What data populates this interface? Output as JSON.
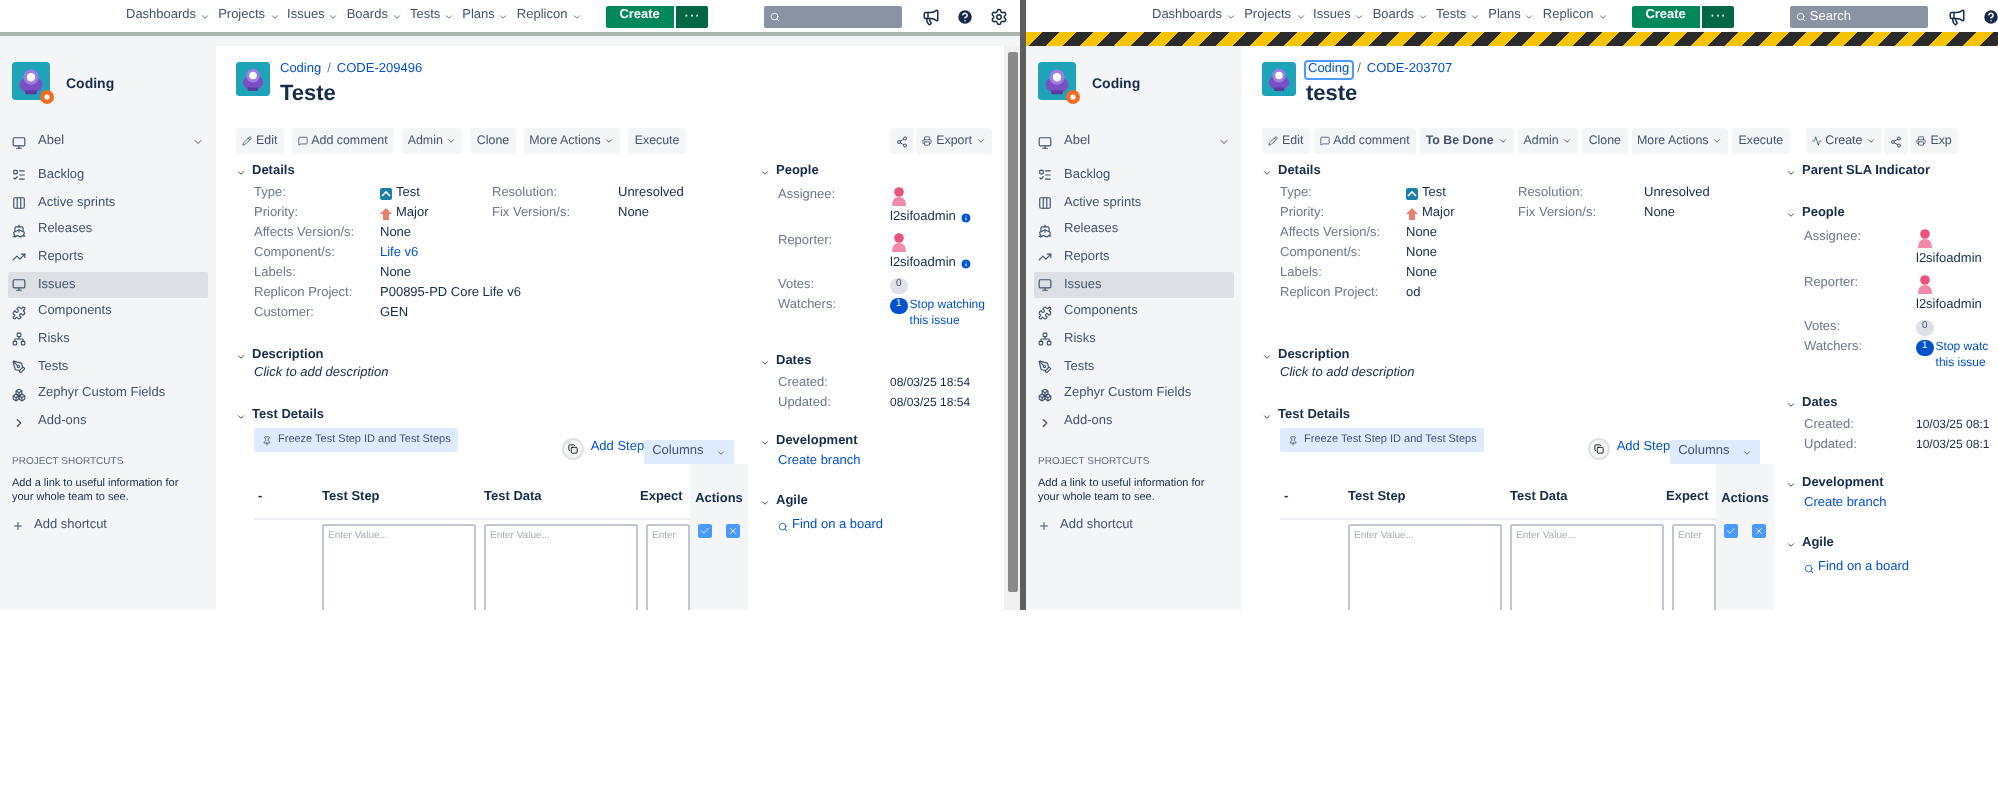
{
  "panes": [
    {
      "hazard": false,
      "nav": {
        "items": [
          "Dashboards",
          "Projects",
          "Issues",
          "Boards",
          "Tests",
          "Plans",
          "Replicon"
        ],
        "create": "Create",
        "more": "···"
      },
      "sidebar": {
        "project": "Coding",
        "board": "Abel",
        "items": [
          {
            "label": "Backlog",
            "kind": "backlog",
            "selected": false
          },
          {
            "label": "Active sprints",
            "kind": "sprints",
            "selected": false
          },
          {
            "label": "Releases",
            "kind": "releases",
            "selected": false
          },
          {
            "label": "Reports",
            "kind": "reports",
            "selected": false
          },
          {
            "label": "Issues",
            "kind": "issues",
            "selected": true
          },
          {
            "label": "Components",
            "kind": "components",
            "selected": false
          },
          {
            "label": "Risks",
            "kind": "risks",
            "selected": false
          },
          {
            "label": "Tests",
            "kind": "tests",
            "selected": false
          },
          {
            "label": "Zephyr Custom Fields",
            "kind": "fields",
            "selected": false
          },
          {
            "label": "Add-ons",
            "kind": "addons",
            "selected": false
          }
        ],
        "shortcuts_title": "PROJECT SHORTCUTS",
        "shortcuts_text": "Add a link to useful information for your whole team to see.",
        "add_shortcut": "Add shortcut"
      },
      "issue": {
        "project": "Coding",
        "project_focused": false,
        "separator": "/",
        "key": "CODE-209496",
        "title": "Teste"
      },
      "toolbar": {
        "left": [
          {
            "label": "Edit",
            "kind": "edit"
          },
          {
            "label": "Add comment",
            "kind": "comment"
          },
          {
            "label": "Admin",
            "kind": "menu"
          },
          {
            "label": "Clone",
            "kind": "plain"
          },
          {
            "label": "More Actions",
            "kind": "menu"
          },
          {
            "label": "Execute",
            "kind": "plain"
          }
        ],
        "right": [
          {
            "kind": "share"
          },
          {
            "label": "Export",
            "kind": "export"
          }
        ]
      },
      "details": {
        "title": "Details",
        "fields": [
          {
            "label": "Type:",
            "value": "Test",
            "kind": "issuetype"
          },
          {
            "label": "Priority:",
            "value": "Major",
            "kind": "priority"
          },
          {
            "label": "Affects Version/s:",
            "value": "None",
            "kind": "text"
          },
          {
            "label": "Component/s:",
            "value": "Life v6",
            "kind": "link"
          },
          {
            "label": "Labels:",
            "value": "None",
            "kind": "text"
          },
          {
            "label": "Replicon Project:",
            "value": "P00895-PD Core Life v6",
            "kind": "text"
          },
          {
            "label": "Customer:",
            "value": "GEN",
            "kind": "text"
          }
        ],
        "side_fields": [
          {
            "label": "Resolution:",
            "value": "Unresolved"
          },
          {
            "label": "Fix Version/s:",
            "value": "None"
          }
        ]
      },
      "description": {
        "title": "Description",
        "text": "Click to add description"
      },
      "test_details": {
        "title": "Test Details",
        "freeze": "Freeze Test Step ID and Test Steps",
        "add_step": "Add Step",
        "columns_button": "Columns",
        "columns": [
          "-",
          "Test Step",
          "Test Data",
          "Expect",
          "Actions"
        ],
        "placeholders": [
          "Enter Value...",
          "Enter Value...",
          "Enter"
        ]
      },
      "people": {
        "title": "People",
        "rows": [
          {
            "label": "Assignee:",
            "user": "l2sifoadmin",
            "info": true
          },
          {
            "label": "Reporter:",
            "user": "l2sifoadmin",
            "info": true
          }
        ],
        "votes_label": "Votes:",
        "votes": "0",
        "watchers_label": "Watchers:",
        "watchers": "1",
        "watch_lines": [
          "Stop watching",
          "this issue"
        ]
      },
      "dates": {
        "title": "Dates",
        "rows": [
          {
            "label": "Created:",
            "value": "08/03/25 18:54"
          },
          {
            "label": "Updated:",
            "value": "08/03/25 18:54"
          }
        ]
      },
      "development": {
        "title": "Development",
        "link": "Create branch"
      },
      "agile": {
        "title": "Agile",
        "link": "Find on a board"
      }
    },
    {
      "hazard": true,
      "nav": {
        "items": [
          "Dashboards",
          "Projects",
          "Issues",
          "Boards",
          "Tests",
          "Plans",
          "Replicon"
        ],
        "create": "Create",
        "more": "···",
        "search_placeholder": "Search"
      },
      "sidebar": {
        "project": "Coding",
        "board": "Abel",
        "items": [
          {
            "label": "Backlog",
            "kind": "backlog",
            "selected": false
          },
          {
            "label": "Active sprints",
            "kind": "sprints",
            "selected": false
          },
          {
            "label": "Releases",
            "kind": "releases",
            "selected": false
          },
          {
            "label": "Reports",
            "kind": "reports",
            "selected": false
          },
          {
            "label": "Issues",
            "kind": "issues",
            "selected": true
          },
          {
            "label": "Components",
            "kind": "components",
            "selected": false
          },
          {
            "label": "Risks",
            "kind": "risks",
            "selected": false
          },
          {
            "label": "Tests",
            "kind": "tests",
            "selected": false
          },
          {
            "label": "Zephyr Custom Fields",
            "kind": "fields",
            "selected": false
          },
          {
            "label": "Add-ons",
            "kind": "addons",
            "selected": false
          }
        ],
        "shortcuts_title": "PROJECT SHORTCUTS",
        "shortcuts_text": "Add a link to useful information for your whole team to see.",
        "add_shortcut": "Add shortcut"
      },
      "issue": {
        "project": "Coding",
        "project_focused": true,
        "separator": "/",
        "key": "CODE-203707",
        "title": "teste"
      },
      "toolbar": {
        "left": [
          {
            "label": "Edit",
            "kind": "edit"
          },
          {
            "label": "Add comment",
            "kind": "comment"
          },
          {
            "label": "To Be Done",
            "kind": "status"
          },
          {
            "label": "Admin",
            "kind": "menu"
          },
          {
            "label": "Clone",
            "kind": "plain"
          },
          {
            "label": "More Actions",
            "kind": "menu"
          },
          {
            "label": "Execute",
            "kind": "plain"
          }
        ],
        "right": [
          {
            "label": "Create",
            "kind": "workflow"
          },
          {
            "kind": "share"
          },
          {
            "label": "Exp",
            "kind": "export"
          }
        ]
      },
      "details": {
        "title": "Details",
        "fields": [
          {
            "label": "Type:",
            "value": "Test",
            "kind": "issuetype"
          },
          {
            "label": "Priority:",
            "value": "Major",
            "kind": "priority"
          },
          {
            "label": "Affects Version/s:",
            "value": "None",
            "kind": "text"
          },
          {
            "label": "Component/s:",
            "value": "None",
            "kind": "text"
          },
          {
            "label": "Labels:",
            "value": "None",
            "kind": "text"
          },
          {
            "label": "Replicon Project:",
            "value": "od",
            "kind": "text"
          }
        ],
        "side_fields": [
          {
            "label": "Resolution:",
            "value": "Unresolved"
          },
          {
            "label": "Fix Version/s:",
            "value": "None"
          }
        ]
      },
      "description": {
        "title": "Description",
        "text": "Click to add description"
      },
      "test_details": {
        "title": "Test Details",
        "freeze": "Freeze Test Step ID and Test Steps",
        "add_step": "Add Step",
        "columns_button": "Columns",
        "columns": [
          "-",
          "Test Step",
          "Test Data",
          "Expect",
          "Actions"
        ],
        "placeholders": [
          "Enter Value...",
          "Enter Value...",
          "Enter"
        ]
      },
      "sla": {
        "title": "Parent SLA Indicator"
      },
      "people": {
        "title": "People",
        "rows": [
          {
            "label": "Assignee:",
            "user": "l2sifoadmin",
            "info": false
          },
          {
            "label": "Reporter:",
            "user": "l2sifoadmin",
            "info": false
          }
        ],
        "votes_label": "Votes:",
        "votes": "0",
        "watchers_label": "Watchers:",
        "watchers": "1",
        "watch_lines": [
          "Stop watc",
          "this issue"
        ]
      },
      "dates": {
        "title": "Dates",
        "rows": [
          {
            "label": "Created:",
            "value": "10/03/25 08:1"
          },
          {
            "label": "Updated:",
            "value": "10/03/25 08:1"
          }
        ]
      },
      "development": {
        "title": "Development",
        "link": "Create branch"
      },
      "agile": {
        "title": "Agile",
        "link": "Find on a board"
      }
    }
  ]
}
